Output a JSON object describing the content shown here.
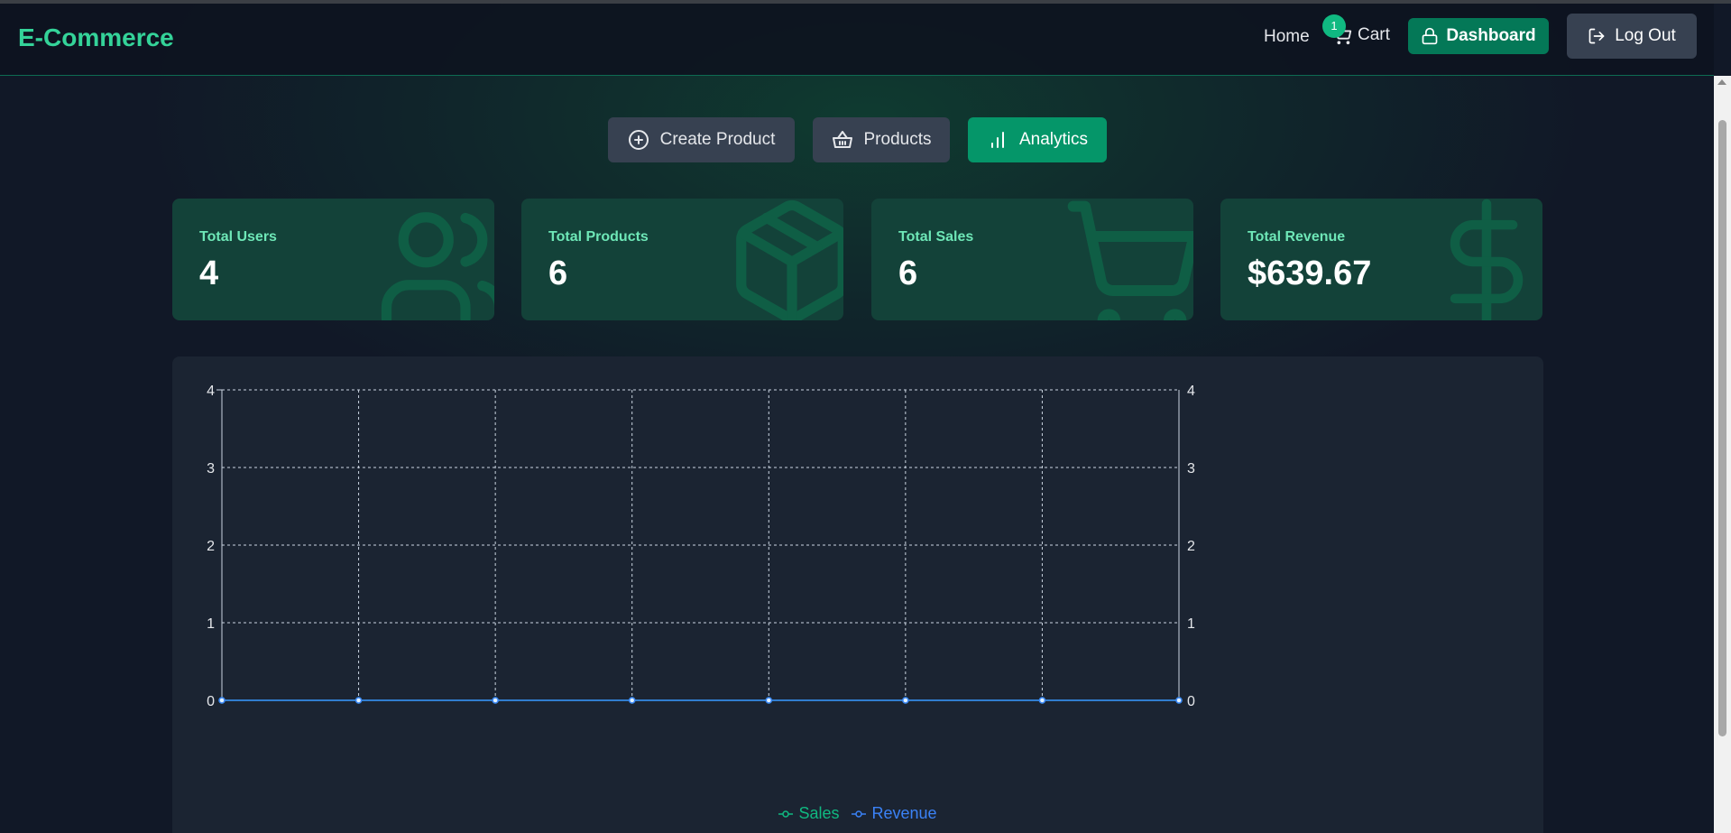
{
  "brand": "E-Commerce",
  "nav": {
    "home": "Home",
    "cart": "Cart",
    "cart_count": "1",
    "dashboard": "Dashboard",
    "logout": "Log Out"
  },
  "tabs": [
    {
      "label": "Create Product",
      "icon": "plus-circle-icon",
      "active": false
    },
    {
      "label": "Products",
      "icon": "basket-icon",
      "active": false
    },
    {
      "label": "Analytics",
      "icon": "bar-chart-icon",
      "active": true
    }
  ],
  "stats": [
    {
      "label": "Total Users",
      "value": "4",
      "icon": "users-icon"
    },
    {
      "label": "Total Products",
      "value": "6",
      "icon": "package-icon"
    },
    {
      "label": "Total Sales",
      "value": "6",
      "icon": "shopping-cart-icon"
    },
    {
      "label": "Total Revenue",
      "value": "$639.67",
      "icon": "dollar-sign-icon"
    }
  ],
  "colors": {
    "accent": "#10b981",
    "sales": "#10b981",
    "revenue": "#3b82f6"
  },
  "chart_data": {
    "type": "line",
    "x": [
      "",
      "",
      "",
      "",
      "",
      "",
      "",
      ""
    ],
    "series": [
      {
        "name": "Sales",
        "values": [
          0,
          0,
          0,
          0,
          0,
          0,
          0,
          0
        ],
        "axis": "left"
      },
      {
        "name": "Revenue",
        "values": [
          0,
          0,
          0,
          0,
          0,
          0,
          0,
          0
        ],
        "axis": "right"
      }
    ],
    "ylim": [
      0,
      4
    ],
    "yticks": [
      "0",
      "1",
      "2",
      "3",
      "4"
    ],
    "y2lim": [
      0,
      4
    ],
    "y2ticks": [
      "0",
      "1",
      "2",
      "3",
      "4"
    ],
    "grid": true,
    "legend": "bottom-center"
  }
}
